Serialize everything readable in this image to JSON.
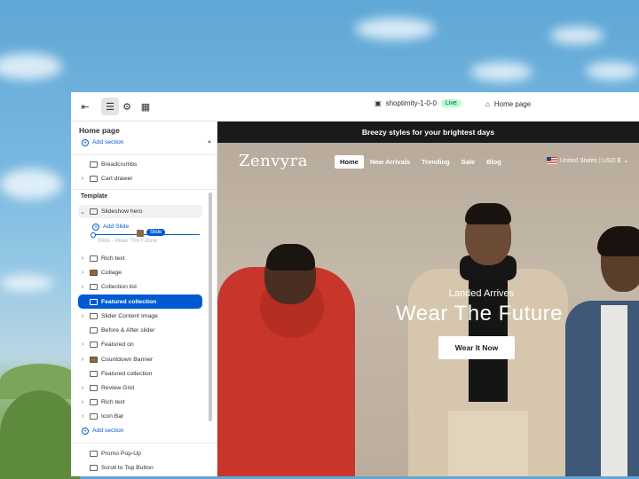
{
  "colors": {
    "accent": "#005bd3",
    "live_bg": "#b4fed2",
    "announce_bg": "#1a1a1a"
  },
  "topbar": {
    "icons": [
      "exit-icon",
      "sections-icon",
      "settings-icon",
      "apps-icon"
    ],
    "store_name": "shoptimity-1-0-0",
    "live_badge": "Live",
    "page_selector": "Home page"
  },
  "sidebar": {
    "title": "Home page",
    "add_section_top": "Add section",
    "header_items": [
      "Breadcrumbs",
      "Cart drawer"
    ],
    "template_label": "Template",
    "slideshow": {
      "label": "Slideshow hero",
      "add_slide": "Add Slide",
      "ghost_slide": "Slide - Wear The Future",
      "drag_tag": "Slide"
    },
    "template_items": [
      "Rich text",
      "Collage",
      "Collection list",
      "Featured collection",
      "Slider Content Image",
      "Before & After slider",
      "Featured on",
      "Countdown Banner",
      "Featured collection",
      "Review Grid",
      "Rich text",
      "Icon Bar"
    ],
    "add_section_bottom": "Add section",
    "footer_items": [
      "Promo Pop-Up",
      "Scroll to Top Button"
    ]
  },
  "preview": {
    "announcement": "Breezy styles for your brightest days",
    "logo": "Zenvyra",
    "nav": [
      "Home",
      "New Arrivals",
      "Trending",
      "Sale",
      "Blog"
    ],
    "locale": "United States | USD $",
    "hero_subtitle": "Landed Arrives",
    "hero_title": "Wear The Future",
    "hero_button": "Wear It Now"
  }
}
